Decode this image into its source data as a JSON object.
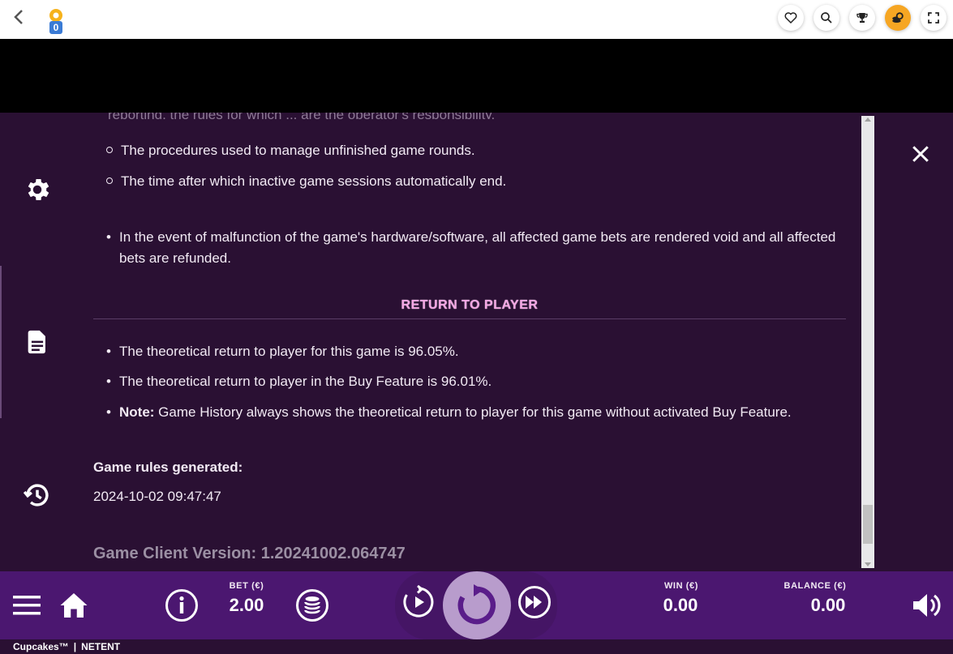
{
  "topbar": {
    "back_icon": "chevron-left-icon",
    "logo_badge": "0",
    "buttons": [
      "heart-icon",
      "search-icon",
      "trophy-icon",
      "coins-icon",
      "fullscreen-icon"
    ]
  },
  "sidebar": {
    "icons": [
      "gear-icon",
      "document-icon",
      "history-icon"
    ]
  },
  "rules": {
    "cut_line": "reporting, the rules for which ... are the operator's responsibility.",
    "sub_items": [
      "The procedures used to manage unfinished game rounds.",
      "The time after which inactive game sessions automatically end."
    ],
    "malfunction": "In the event of malfunction of the game's hardware/software, all affected game bets are rendered void and all affected bets are refunded.",
    "rtp_title": "RETURN TO PLAYER",
    "rtp_items": [
      "The theoretical return to player for this game is 96.05%.",
      "The theoretical return to player in the Buy Feature is 96.01%."
    ],
    "note_label": "Note:",
    "note_text": " Game History always shows the theoretical return to player for this game without activated Buy Feature.",
    "generated_label": "Game rules generated:",
    "generated_value": "2024-10-02 09:47:47",
    "version": "Game Client Version: 1.20241002.064747"
  },
  "controls": {
    "bet_label": "BET (€)",
    "bet_value": "2.00",
    "win_label": "WIN (€)",
    "win_value": "0.00",
    "balance_label": "BALANCE (€)",
    "balance_value": "0.00"
  },
  "footer": {
    "game": "Cupcakes™",
    "separator": "|",
    "provider": "NETENT"
  },
  "colors": {
    "panel_bg": "#2a1033",
    "controls_bg": "#4b1770",
    "rtp_title": "#f5a6e4",
    "spin_button": "#b89ccc",
    "coin_button": "#f6a623"
  }
}
